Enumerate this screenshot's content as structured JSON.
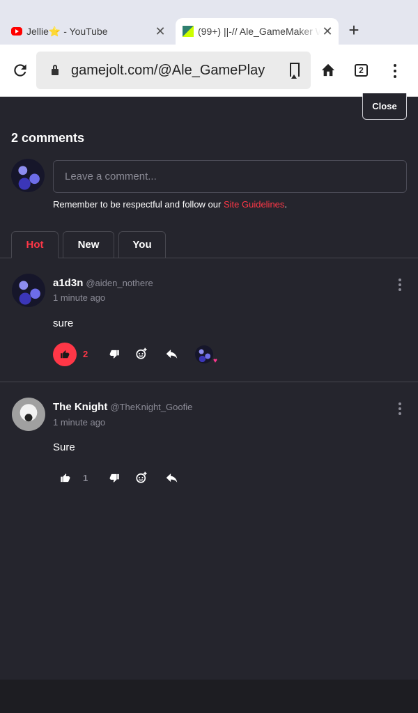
{
  "browser": {
    "tabs": [
      {
        "title": "Jellie⭐ - YouTube",
        "favicon": "youtube-icon"
      },
      {
        "title": "(99+) ||-// Ale_GameMaker \\/",
        "favicon": "gamejolt-icon"
      }
    ],
    "tab_count": "2",
    "url": "gamejolt.com/@Ale_GamePlay"
  },
  "panel": {
    "close_label": "Close",
    "comments_count": "2 comments",
    "input_placeholder": "Leave a comment...",
    "guidelines_text": "Remember to be respectful and follow our ",
    "guidelines_link": "Site Guidelines",
    "guidelines_end": "."
  },
  "sort_tabs": {
    "hot": "Hot",
    "new": "New",
    "you": "You",
    "active": "Hot"
  },
  "comments": [
    {
      "author": "a1d3n",
      "handle": "@aiden_nothere",
      "time": "1 minute ago",
      "text": "sure",
      "likes": "2",
      "liked": true
    },
    {
      "author": "The Knight",
      "handle": "@TheKnight_Goofie",
      "time": "1 minute ago",
      "text": "Sure",
      "likes": "1",
      "liked": false
    }
  ],
  "colors": {
    "accent": "#ff3747",
    "background": "#25252d"
  }
}
